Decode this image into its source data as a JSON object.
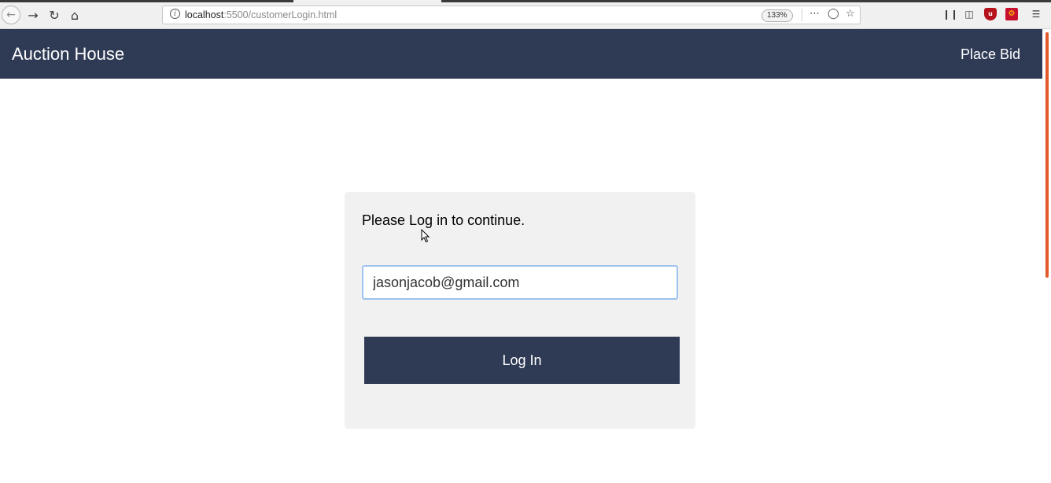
{
  "browser": {
    "url_host": "localhost",
    "url_path": ":5500/customerLogin.html",
    "zoom": "133%",
    "icons": [
      "back-icon",
      "forward-icon",
      "reload-icon",
      "home-icon",
      "info-icon",
      "more-icon",
      "pocket-icon",
      "bookmark-star-icon",
      "library-icon",
      "sidebar-icon",
      "ublock-icon",
      "addon-icon",
      "menu-icon"
    ]
  },
  "header": {
    "brand": "Auction House",
    "nav_link": "Place Bid",
    "bg_color": "#2f3b55"
  },
  "login": {
    "prompt": "Please Log in to continue.",
    "email_value": "jasonjacob@gmail.com",
    "button_label": "Log In"
  }
}
